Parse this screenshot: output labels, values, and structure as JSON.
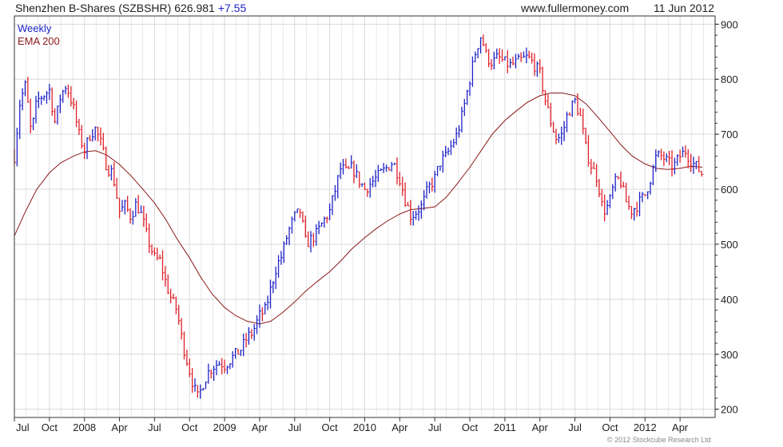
{
  "header": {
    "title": "Shenzhen B-Shares (SZBSHR) 626.981",
    "change": "+7.55",
    "site": "www.fullermoney.com",
    "date": "11 Jun 2012"
  },
  "copyright": "© 2012 Stockcube Research Ltd",
  "chart_data": {
    "type": "line",
    "legend": [
      "Weekly",
      "EMA 200"
    ],
    "legend_placement": "top-left",
    "colors": {
      "up": "#1f23c8",
      "down": "#e0202a",
      "ema": "#8b1a1a",
      "grid": "#d9d9d9",
      "axis": "#333333"
    },
    "grid": true,
    "ylim": [
      185,
      915
    ],
    "yticks": [
      200,
      300,
      400,
      500,
      600,
      700,
      800,
      900
    ],
    "xlim": [
      2007.5,
      2012.5
    ],
    "xticks": [
      {
        "x": 2007.5,
        "label": "Jul"
      },
      {
        "x": 2007.75,
        "label": "Oct"
      },
      {
        "x": 2008.0,
        "label": "2008"
      },
      {
        "x": 2008.25,
        "label": "Apr"
      },
      {
        "x": 2008.5,
        "label": "Jul"
      },
      {
        "x": 2008.75,
        "label": "Oct"
      },
      {
        "x": 2009.0,
        "label": "2009"
      },
      {
        "x": 2009.25,
        "label": "Apr"
      },
      {
        "x": 2009.5,
        "label": "Jul"
      },
      {
        "x": 2009.75,
        "label": "Oct"
      },
      {
        "x": 2010.0,
        "label": "2010"
      },
      {
        "x": 2010.25,
        "label": "Apr"
      },
      {
        "x": 2010.5,
        "label": "Jul"
      },
      {
        "x": 2010.75,
        "label": "Oct"
      },
      {
        "x": 2011.0,
        "label": "2011"
      },
      {
        "x": 2011.25,
        "label": "Apr"
      },
      {
        "x": 2011.5,
        "label": "Jul"
      },
      {
        "x": 2011.75,
        "label": "Oct"
      },
      {
        "x": 2012.0,
        "label": "2012"
      },
      {
        "x": 2012.25,
        "label": "Apr"
      }
    ],
    "price_path": [
      [
        2007.5,
        660
      ],
      [
        2007.54,
        760
      ],
      [
        2007.58,
        790
      ],
      [
        2007.62,
        700
      ],
      [
        2007.66,
        760
      ],
      [
        2007.7,
        770
      ],
      [
        2007.75,
        780
      ],
      [
        2007.79,
        720
      ],
      [
        2007.83,
        770
      ],
      [
        2007.87,
        790
      ],
      [
        2007.92,
        750
      ],
      [
        2007.96,
        700
      ],
      [
        2008.0,
        670
      ],
      [
        2008.04,
        700
      ],
      [
        2008.08,
        710
      ],
      [
        2008.12,
        680
      ],
      [
        2008.16,
        640
      ],
      [
        2008.2,
        630
      ],
      [
        2008.25,
        560
      ],
      [
        2008.29,
        570
      ],
      [
        2008.33,
        550
      ],
      [
        2008.37,
        575
      ],
      [
        2008.41,
        550
      ],
      [
        2008.45,
        510
      ],
      [
        2008.5,
        475
      ],
      [
        2008.54,
        470
      ],
      [
        2008.58,
        430
      ],
      [
        2008.62,
        400
      ],
      [
        2008.66,
        380
      ],
      [
        2008.7,
        320
      ],
      [
        2008.74,
        280
      ],
      [
        2008.78,
        240
      ],
      [
        2008.81,
        220
      ],
      [
        2008.85,
        250
      ],
      [
        2008.89,
        270
      ],
      [
        2008.93,
        280
      ],
      [
        2008.97,
        285
      ],
      [
        2009.0,
        280
      ],
      [
        2009.04,
        290
      ],
      [
        2009.08,
        300
      ],
      [
        2009.12,
        310
      ],
      [
        2009.16,
        330
      ],
      [
        2009.2,
        340
      ],
      [
        2009.25,
        370
      ],
      [
        2009.29,
        380
      ],
      [
        2009.33,
        420
      ],
      [
        2009.37,
        460
      ],
      [
        2009.41,
        480
      ],
      [
        2009.45,
        520
      ],
      [
        2009.5,
        550
      ],
      [
        2009.54,
        560
      ],
      [
        2009.58,
        500
      ],
      [
        2009.62,
        510
      ],
      [
        2009.66,
        520
      ],
      [
        2009.7,
        540
      ],
      [
        2009.75,
        560
      ],
      [
        2009.79,
        600
      ],
      [
        2009.83,
        640
      ],
      [
        2009.87,
        630
      ],
      [
        2009.91,
        640
      ],
      [
        2009.95,
        620
      ],
      [
        2010.0,
        600
      ],
      [
        2010.04,
        610
      ],
      [
        2010.08,
        620
      ],
      [
        2010.12,
        630
      ],
      [
        2010.16,
        640
      ],
      [
        2010.2,
        650
      ],
      [
        2010.25,
        620
      ],
      [
        2010.29,
        580
      ],
      [
        2010.33,
        550
      ],
      [
        2010.37,
        560
      ],
      [
        2010.41,
        570
      ],
      [
        2010.45,
        600
      ],
      [
        2010.5,
        620
      ],
      [
        2010.54,
        650
      ],
      [
        2010.58,
        660
      ],
      [
        2010.62,
        680
      ],
      [
        2010.66,
        700
      ],
      [
        2010.7,
        740
      ],
      [
        2010.75,
        800
      ],
      [
        2010.79,
        850
      ],
      [
        2010.83,
        880
      ],
      [
        2010.87,
        840
      ],
      [
        2010.91,
        830
      ],
      [
        2010.95,
        840
      ],
      [
        2011.0,
        830
      ],
      [
        2011.04,
        825
      ],
      [
        2011.08,
        830
      ],
      [
        2011.12,
        835
      ],
      [
        2011.16,
        840
      ],
      [
        2011.2,
        830
      ],
      [
        2011.25,
        810
      ],
      [
        2011.29,
        760
      ],
      [
        2011.33,
        720
      ],
      [
        2011.37,
        690
      ],
      [
        2011.41,
        700
      ],
      [
        2011.45,
        740
      ],
      [
        2011.5,
        760
      ],
      [
        2011.54,
        730
      ],
      [
        2011.58,
        670
      ],
      [
        2011.62,
        640
      ],
      [
        2011.66,
        620
      ],
      [
        2011.7,
        560
      ],
      [
        2011.74,
        570
      ],
      [
        2011.78,
        610
      ],
      [
        2011.82,
        620
      ],
      [
        2011.86,
        580
      ],
      [
        2011.9,
        560
      ],
      [
        2011.94,
        570
      ],
      [
        2012.0,
        590
      ],
      [
        2012.04,
        620
      ],
      [
        2012.08,
        660
      ],
      [
        2012.12,
        660
      ],
      [
        2012.16,
        650
      ],
      [
        2012.2,
        640
      ],
      [
        2012.25,
        660
      ],
      [
        2012.29,
        670
      ],
      [
        2012.33,
        650
      ],
      [
        2012.37,
        640
      ],
      [
        2012.41,
        626.981
      ]
    ],
    "ema_path": [
      [
        2007.5,
        515
      ],
      [
        2007.58,
        560
      ],
      [
        2007.66,
        600
      ],
      [
        2007.75,
        630
      ],
      [
        2007.83,
        648
      ],
      [
        2007.92,
        660
      ],
      [
        2008.0,
        668
      ],
      [
        2008.08,
        670
      ],
      [
        2008.16,
        662
      ],
      [
        2008.25,
        645
      ],
      [
        2008.33,
        625
      ],
      [
        2008.41,
        602
      ],
      [
        2008.5,
        575
      ],
      [
        2008.58,
        545
      ],
      [
        2008.66,
        510
      ],
      [
        2008.75,
        475
      ],
      [
        2008.83,
        440
      ],
      [
        2008.91,
        410
      ],
      [
        2009.0,
        385
      ],
      [
        2009.08,
        370
      ],
      [
        2009.16,
        360
      ],
      [
        2009.25,
        355
      ],
      [
        2009.33,
        360
      ],
      [
        2009.41,
        375
      ],
      [
        2009.5,
        395
      ],
      [
        2009.58,
        415
      ],
      [
        2009.66,
        432
      ],
      [
        2009.75,
        450
      ],
      [
        2009.83,
        470
      ],
      [
        2009.91,
        492
      ],
      [
        2010.0,
        512
      ],
      [
        2010.08,
        528
      ],
      [
        2010.16,
        542
      ],
      [
        2010.25,
        555
      ],
      [
        2010.33,
        563
      ],
      [
        2010.41,
        565
      ],
      [
        2010.5,
        568
      ],
      [
        2010.58,
        585
      ],
      [
        2010.66,
        610
      ],
      [
        2010.75,
        640
      ],
      [
        2010.83,
        670
      ],
      [
        2010.91,
        700
      ],
      [
        2011.0,
        725
      ],
      [
        2011.08,
        742
      ],
      [
        2011.16,
        758
      ],
      [
        2011.25,
        770
      ],
      [
        2011.33,
        775
      ],
      [
        2011.41,
        775
      ],
      [
        2011.5,
        770
      ],
      [
        2011.58,
        755
      ],
      [
        2011.66,
        732
      ],
      [
        2011.75,
        705
      ],
      [
        2011.83,
        680
      ],
      [
        2011.91,
        660
      ],
      [
        2012.0,
        646
      ],
      [
        2012.08,
        638
      ],
      [
        2012.16,
        636
      ],
      [
        2012.25,
        638
      ],
      [
        2012.33,
        642
      ],
      [
        2012.41,
        640
      ]
    ]
  }
}
